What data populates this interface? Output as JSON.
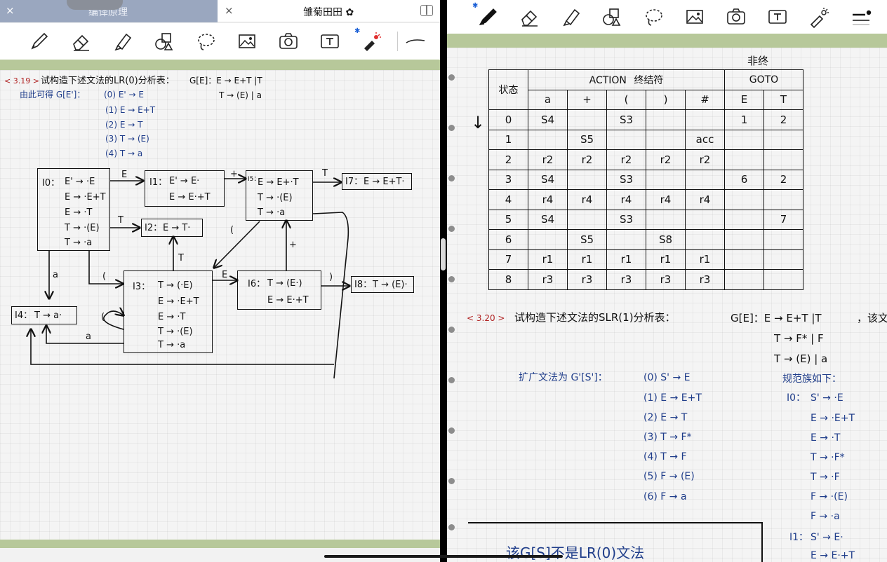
{
  "left_tabs": {
    "inactive_title": "编译原理",
    "active_title": "雏菊田田 ✿",
    "close_symbol": "×"
  },
  "left_toolbar_icons": [
    "pen-icon",
    "eraser-icon",
    "highlighter-icon",
    "shapes-icon",
    "lasso-icon",
    "image-icon",
    "camera-icon",
    "text-box-icon",
    "laser-pointer-icon",
    "stroke-style-icon"
  ],
  "right_toolbar_icons": [
    "pen-icon",
    "eraser-icon",
    "highlighter-icon",
    "shapes-icon",
    "lasso-icon",
    "image-icon",
    "camera-icon",
    "text-box-icon",
    "laser-pointer-icon",
    "stroke-width-icon"
  ],
  "left_note": {
    "problem_num": "< 3.19 >",
    "problem_text": "试构造下述文法的LR(0)分析表：",
    "grammar_head": "G[E]：E → E+T |T",
    "grammar_line2": "T → (E) | a",
    "augmented_label": "由此可得 G[E']：",
    "productions": [
      "(0) E' → E",
      "(1) E → E+T",
      "(2) E → T",
      "(3) T → (E)",
      "(4) T → a"
    ],
    "states": {
      "I0": {
        "label": "I0：",
        "items": [
          "E' → ·E",
          "E → ·E+T",
          "E → ·T",
          "T → ·(E)",
          "T → ·a"
        ]
      },
      "I1": {
        "label": "I1：",
        "items": [
          "E' → E·",
          "E → E·+T"
        ]
      },
      "I2": {
        "label": "I2：",
        "items": [
          "E → T·"
        ]
      },
      "I3": {
        "label": "I3：",
        "items": [
          "T → (·E)",
          "E → ·E+T",
          "E → ·T",
          "T → ·(E)",
          "T → ·a"
        ]
      },
      "I4": {
        "label": "I4：",
        "items": [
          "T → a·"
        ]
      },
      "I5": {
        "label": "I5：",
        "items": [
          "E → E+·T",
          "T → ·(E)",
          "T → ·a"
        ]
      },
      "I6": {
        "label": "I6：",
        "items": [
          "T → (E·)",
          "E → E·+T"
        ]
      },
      "I7": {
        "label": "I7：",
        "items": [
          "E → E+T·"
        ]
      },
      "I8": {
        "label": "I8：",
        "items": [
          "T → (E)·"
        ]
      }
    },
    "edge_labels": {
      "e_I0_I1": "E",
      "e_I0_I2": "T",
      "e_I0_I4": "a",
      "e_I0_I3": "(",
      "e_I1_I5": "+",
      "e_I5_I7": "T",
      "e_I5_I3": "(",
      "e_I3_I2": "T",
      "e_I3_I6": "E",
      "e_I3_self": "(",
      "e_I3_I4": "a",
      "e_I6_I5": "+",
      "e_I6_I8": ")"
    }
  },
  "table": {
    "top_note": "非终",
    "state_header": "状态",
    "action_header": "ACTION",
    "action_note": "终结符",
    "goto_header": "GOTO",
    "columns": [
      "a",
      "+",
      "(",
      ")",
      "#",
      "E",
      "T"
    ],
    "rows": [
      [
        "0",
        "S4",
        "",
        "S3",
        "",
        "",
        "1",
        "2"
      ],
      [
        "1",
        "",
        "S5",
        "",
        "",
        "acc",
        "",
        ""
      ],
      [
        "2",
        "r2",
        "r2",
        "r2",
        "r2",
        "r2",
        "",
        ""
      ],
      [
        "3",
        "S4",
        "",
        "S3",
        "",
        "",
        "6",
        "2"
      ],
      [
        "4",
        "r4",
        "r4",
        "r4",
        "r4",
        "r4",
        "",
        ""
      ],
      [
        "5",
        "S4",
        "",
        "S3",
        "",
        "",
        "",
        "7"
      ],
      [
        "6",
        "",
        "S5",
        "",
        "S8",
        "",
        "",
        ""
      ],
      [
        "7",
        "r1",
        "r1",
        "r1",
        "r1",
        "r1",
        "",
        ""
      ],
      [
        "8",
        "r3",
        "r3",
        "r3",
        "r3",
        "r3",
        "",
        ""
      ]
    ],
    "side_arrow": "↓"
  },
  "right_note": {
    "problem_num": "< 3.20 >",
    "problem_text": "试构造下述文法的SLR(1)分析表：",
    "grammar_head": "G[E]：E → E+T |T",
    "grammar_tail": "，该文",
    "grammar_line2": "T → F* | F",
    "grammar_line3": "T → (E) | a",
    "augmented_label": "扩广文法为 G'[S']：",
    "productions": [
      "(0) S' → E",
      "(1) E → E+T",
      "(2) E → T",
      "(3) T → F*",
      "(4) T → F",
      "(5) F → (E)",
      "(6) F → a"
    ],
    "family_label": "规范族如下：",
    "I0_label": "I0：",
    "I0_items": [
      "S' → ·E",
      "E → ·E+T",
      "E → ·T",
      "T → ·F*",
      "T → ·F",
      "F → ·(E)",
      "F → ·a"
    ],
    "I1_label": "I1：",
    "I1_items": [
      "S' → E·",
      "E → E·+T"
    ],
    "conclusion": "该G[S]不是LR(0)文法"
  }
}
